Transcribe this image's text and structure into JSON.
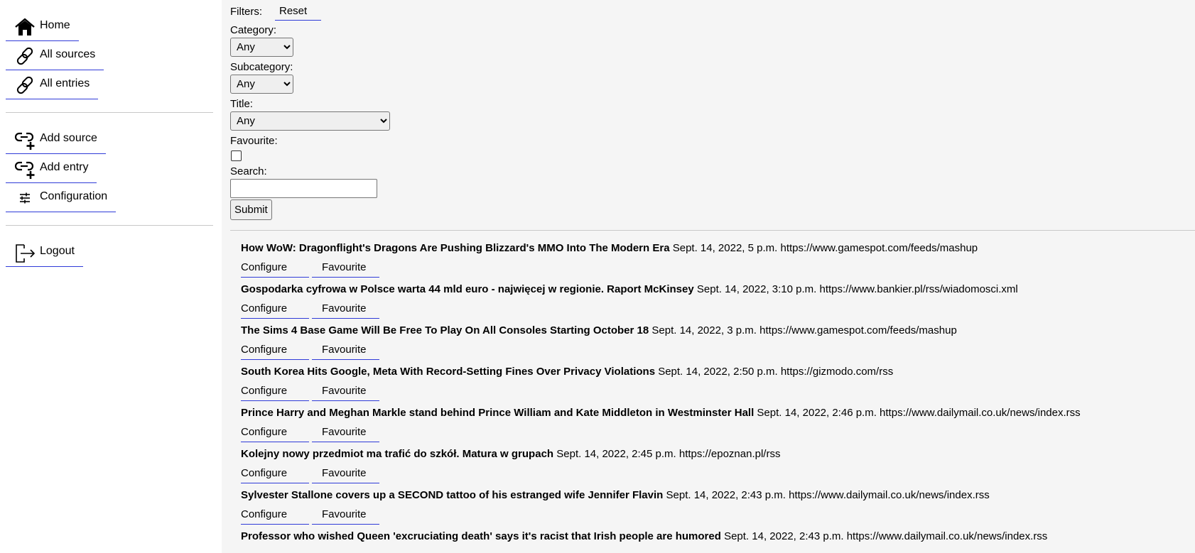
{
  "sidebar": {
    "main_nav": [
      {
        "label": "Home",
        "icon": "home-icon"
      },
      {
        "label": "All sources",
        "icon": "link-icon"
      },
      {
        "label": "All entries",
        "icon": "link-icon"
      }
    ],
    "manage_nav": [
      {
        "label": "Add source",
        "icon": "link-add-icon"
      },
      {
        "label": "Add entry",
        "icon": "link-add-icon"
      },
      {
        "label": "Configuration",
        "icon": "sliders-icon"
      }
    ],
    "account_nav": [
      {
        "label": "Logout",
        "icon": "logout-icon"
      }
    ]
  },
  "filters": {
    "label": "Filters:",
    "reset_label": "Reset",
    "category": {
      "label": "Category:",
      "selected": "Any"
    },
    "subcategory": {
      "label": "Subcategory:",
      "selected": "Any"
    },
    "title": {
      "label": "Title:",
      "selected": "Any"
    },
    "favourite": {
      "label": "Favourite:",
      "checked": false
    },
    "search": {
      "label": "Search:",
      "value": ""
    },
    "submit_label": "Submit"
  },
  "entry_actions": {
    "configure_label": "Configure",
    "favourite_label": "Favourite"
  },
  "entries": [
    {
      "title": "How WoW: Dragonflight's Dragons Are Pushing Blizzard's MMO Into The Modern Era",
      "date": "Sept. 14, 2022, 5 p.m.",
      "source": "https://www.gamespot.com/feeds/mashup"
    },
    {
      "title": "Gospodarka cyfrowa w Polsce warta 44 mld euro - najwięcej w regionie. Raport McKinsey",
      "date": "Sept. 14, 2022, 3:10 p.m.",
      "source": "https://www.bankier.pl/rss/wiadomosci.xml"
    },
    {
      "title": "The Sims 4 Base Game Will Be Free To Play On All Consoles Starting October 18",
      "date": "Sept. 14, 2022, 3 p.m.",
      "source": "https://www.gamespot.com/feeds/mashup"
    },
    {
      "title": "South Korea Hits Google, Meta With Record-Setting Fines Over Privacy Violations",
      "date": "Sept. 14, 2022, 2:50 p.m.",
      "source": "https://gizmodo.com/rss"
    },
    {
      "title": "Prince Harry and Meghan Markle stand behind Prince William and Kate Middleton in Westminster Hall",
      "date": "Sept. 14, 2022, 2:46 p.m.",
      "source": "https://www.dailymail.co.uk/news/index.rss"
    },
    {
      "title": "Kolejny nowy przedmiot ma trafić do szkół. Matura w grupach",
      "date": "Sept. 14, 2022, 2:45 p.m.",
      "source": "https://epoznan.pl/rss"
    },
    {
      "title": "Sylvester Stallone covers up a SECOND tattoo of his estranged wife Jennifer Flavin",
      "date": "Sept. 14, 2022, 2:43 p.m.",
      "source": "https://www.dailymail.co.uk/news/index.rss"
    },
    {
      "title": "Professor who wished Queen 'excruciating death' says it's racist that Irish people are humored",
      "date": "Sept. 14, 2022, 2:43 p.m.",
      "source": "https://www.dailymail.co.uk/news/index.rss"
    }
  ],
  "colors": {
    "link_underline": "#2f3bd8",
    "main_background": "#f5f5f5",
    "divider": "#c8c8c8"
  }
}
